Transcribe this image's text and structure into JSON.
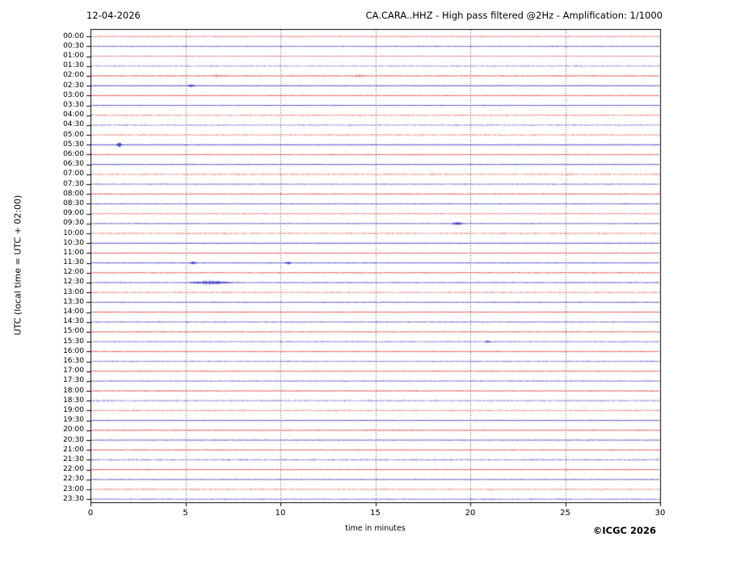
{
  "chart_data": {
    "type": "line",
    "subtype": "helicorder-seismogram",
    "title_left": "12-04-2026",
    "title_right": "CA.CARA..HHZ - High pass filtered @2Hz - Amplification: 1/1000",
    "ylabel": "UTC (local time = UTC + 02:00)",
    "xlabel": "time in minutes",
    "credit": "©ICGC 2026",
    "x_range": [
      0,
      30
    ],
    "x_ticks": [
      "0",
      "5",
      "10",
      "15",
      "20",
      "25",
      "30"
    ],
    "grid": {
      "vertical_dotted_every_minutes": 5,
      "horizontal": false
    },
    "colors": {
      "red_trace": "#dd3333",
      "blue_trace": "#2f2fbe",
      "grid": "#555555",
      "frame": "#000000",
      "background": "#ffffff"
    },
    "legend": "rows alternate red/blue, one 30-minute strip per row",
    "rows": [
      {
        "label": "00:00",
        "color": "red",
        "alpha": 0.55,
        "amp": 0.6,
        "events": []
      },
      {
        "label": "00:30",
        "color": "blue",
        "alpha": 0.7,
        "amp": 0.5,
        "events": []
      },
      {
        "label": "01:00",
        "color": "red",
        "alpha": 0.5,
        "amp": 0.5,
        "events": []
      },
      {
        "label": "01:30",
        "color": "blue",
        "alpha": 0.4,
        "amp": 1.0,
        "events": []
      },
      {
        "label": "02:00",
        "color": "red",
        "alpha": 0.8,
        "amp": 0.5,
        "events": [
          {
            "m": 6.7,
            "w": 0.5,
            "a": 0.8
          },
          {
            "m": 14.1,
            "w": 0.4,
            "a": 0.9
          }
        ]
      },
      {
        "label": "02:30",
        "color": "blue",
        "alpha": 0.9,
        "amp": 0.35,
        "events": [
          {
            "m": 5.3,
            "w": 0.2,
            "a": 1.2
          }
        ]
      },
      {
        "label": "03:00",
        "color": "red",
        "alpha": 0.75,
        "amp": 0.5,
        "events": []
      },
      {
        "label": "03:30",
        "color": "blue",
        "alpha": 0.8,
        "amp": 0.4,
        "events": []
      },
      {
        "label": "04:00",
        "color": "red",
        "alpha": 0.45,
        "amp": 0.9,
        "events": []
      },
      {
        "label": "04:30",
        "color": "blue",
        "alpha": 0.45,
        "amp": 0.9,
        "events": []
      },
      {
        "label": "05:00",
        "color": "red",
        "alpha": 0.45,
        "amp": 0.9,
        "events": []
      },
      {
        "label": "05:30",
        "color": "blue",
        "alpha": 0.9,
        "amp": 0.35,
        "events": [
          {
            "m": 1.5,
            "w": 0.15,
            "a": 2.5
          }
        ]
      },
      {
        "label": "06:00",
        "color": "red",
        "alpha": 0.75,
        "amp": 0.5,
        "events": []
      },
      {
        "label": "06:30",
        "color": "blue",
        "alpha": 0.85,
        "amp": 0.4,
        "events": []
      },
      {
        "label": "07:00",
        "color": "red",
        "alpha": 0.4,
        "amp": 1.2,
        "events": []
      },
      {
        "label": "07:30",
        "color": "blue",
        "alpha": 0.6,
        "amp": 0.6,
        "events": []
      },
      {
        "label": "08:00",
        "color": "red",
        "alpha": 0.75,
        "amp": 0.5,
        "events": []
      },
      {
        "label": "08:30",
        "color": "blue",
        "alpha": 0.75,
        "amp": 0.45,
        "events": []
      },
      {
        "label": "09:00",
        "color": "red",
        "alpha": 0.5,
        "amp": 0.7,
        "events": []
      },
      {
        "label": "09:30",
        "color": "blue",
        "alpha": 0.7,
        "amp": 0.5,
        "events": [
          {
            "m": 19.3,
            "w": 0.3,
            "a": 1.5
          }
        ]
      },
      {
        "label": "10:00",
        "color": "red",
        "alpha": 0.42,
        "amp": 1.1,
        "events": []
      },
      {
        "label": "10:30",
        "color": "blue",
        "alpha": 0.9,
        "amp": 0.35,
        "events": []
      },
      {
        "label": "11:00",
        "color": "red",
        "alpha": 0.8,
        "amp": 0.4,
        "events": []
      },
      {
        "label": "11:30",
        "color": "blue",
        "alpha": 0.8,
        "amp": 0.45,
        "events": [
          {
            "m": 5.4,
            "w": 0.2,
            "a": 1.3
          },
          {
            "m": 10.4,
            "w": 0.2,
            "a": 1.3
          }
        ]
      },
      {
        "label": "12:00",
        "color": "red",
        "alpha": 0.75,
        "amp": 0.5,
        "events": []
      },
      {
        "label": "12:30",
        "color": "blue",
        "alpha": 0.7,
        "amp": 0.55,
        "events": [
          {
            "m": 6.3,
            "w": 1.2,
            "a": 1.6
          }
        ]
      },
      {
        "label": "13:00",
        "color": "red",
        "alpha": 0.42,
        "amp": 1.1,
        "events": []
      },
      {
        "label": "13:30",
        "color": "blue",
        "alpha": 0.75,
        "amp": 0.5,
        "events": []
      },
      {
        "label": "14:00",
        "color": "red",
        "alpha": 0.8,
        "amp": 0.4,
        "events": []
      },
      {
        "label": "14:30",
        "color": "blue",
        "alpha": 0.65,
        "amp": 0.55,
        "events": []
      },
      {
        "label": "15:00",
        "color": "red",
        "alpha": 0.75,
        "amp": 0.5,
        "events": []
      },
      {
        "label": "15:30",
        "color": "blue",
        "alpha": 0.55,
        "amp": 0.7,
        "events": [
          {
            "m": 20.9,
            "w": 0.15,
            "a": 1.2
          }
        ]
      },
      {
        "label": "16:00",
        "color": "red",
        "alpha": 0.75,
        "amp": 0.5,
        "events": []
      },
      {
        "label": "16:30",
        "color": "blue",
        "alpha": 0.55,
        "amp": 0.7,
        "events": []
      },
      {
        "label": "17:00",
        "color": "red",
        "alpha": 0.75,
        "amp": 0.5,
        "events": []
      },
      {
        "label": "17:30",
        "color": "blue",
        "alpha": 0.65,
        "amp": 0.5,
        "events": []
      },
      {
        "label": "18:00",
        "color": "red",
        "alpha": 0.8,
        "amp": 0.45,
        "events": []
      },
      {
        "label": "18:30",
        "color": "blue",
        "alpha": 0.45,
        "amp": 1.1,
        "events": []
      },
      {
        "label": "19:00",
        "color": "red",
        "alpha": 0.45,
        "amp": 0.9,
        "events": []
      },
      {
        "label": "19:30",
        "color": "blue",
        "alpha": 0.85,
        "amp": 0.4,
        "events": []
      },
      {
        "label": "20:00",
        "color": "red",
        "alpha": 0.8,
        "amp": 0.45,
        "events": []
      },
      {
        "label": "20:30",
        "color": "blue",
        "alpha": 0.75,
        "amp": 0.45,
        "events": []
      },
      {
        "label": "21:00",
        "color": "red",
        "alpha": 0.75,
        "amp": 0.5,
        "events": []
      },
      {
        "label": "21:30",
        "color": "blue",
        "alpha": 0.5,
        "amp": 1.0,
        "events": []
      },
      {
        "label": "22:00",
        "color": "red",
        "alpha": 0.8,
        "amp": 0.45,
        "events": []
      },
      {
        "label": "22:30",
        "color": "blue",
        "alpha": 0.75,
        "amp": 0.45,
        "events": []
      },
      {
        "label": "23:00",
        "color": "red",
        "alpha": 0.45,
        "amp": 0.9,
        "events": []
      },
      {
        "label": "23:30",
        "color": "blue",
        "alpha": 0.6,
        "amp": 0.6,
        "events": []
      }
    ]
  }
}
